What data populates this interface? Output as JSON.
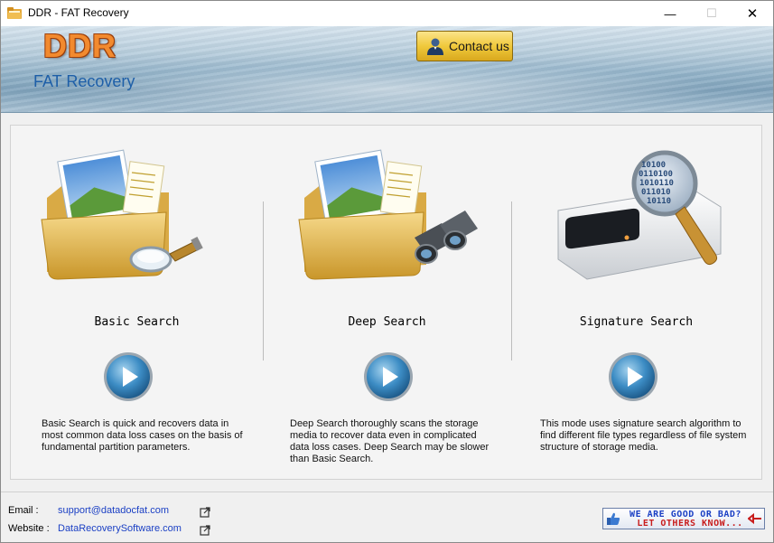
{
  "window": {
    "title": "DDR - FAT Recovery",
    "min_glyph": "—",
    "max_glyph": "☐",
    "close_glyph": "✕"
  },
  "header": {
    "logo": "DDR",
    "subtitle": "FAT Recovery",
    "contact_label": "Contact us",
    "logo_color": "#f28a2e",
    "subtitle_color": "#1e5fa8"
  },
  "modes": [
    {
      "title": "Basic Search",
      "icon": "folder-magnifier-icon",
      "description": "Basic Search is quick and recovers data in most common data loss cases on the basis of fundamental partition parameters."
    },
    {
      "title": "Deep Search",
      "icon": "folder-binoculars-icon",
      "description": "Deep Search thoroughly scans the storage media to recover data even in complicated data loss cases. Deep Search may be slower than Basic Search."
    },
    {
      "title": "Signature Search",
      "icon": "drive-magnifier-icon",
      "description": "This mode uses signature search algorithm to find different file types regardless of file system structure of storage media."
    }
  ],
  "footer": {
    "email_label": "Email :",
    "email": "support@datadocfat.com",
    "website_label": "Website :",
    "website": "DataRecoverySoftware.com",
    "feedback_line1": "WE ARE GOOD OR BAD?",
    "feedback_line2": "LET OTHERS KNOW...",
    "link_color": "#1a3fc4"
  }
}
